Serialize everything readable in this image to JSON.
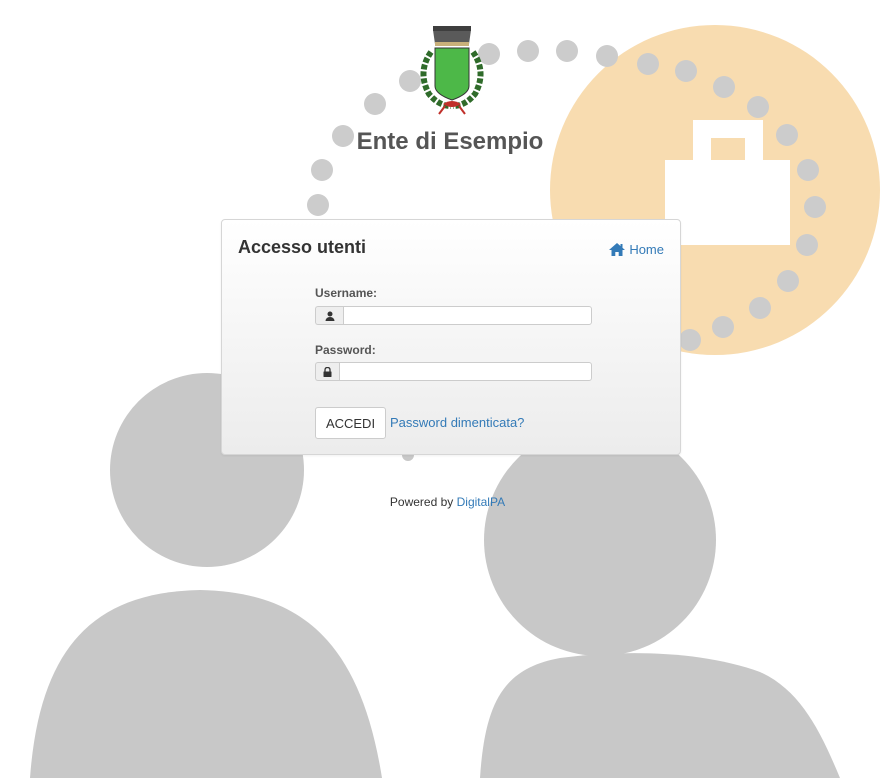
{
  "organization": {
    "name": "Ente di Esempio",
    "crest_icon": "coat-of-arms-icon"
  },
  "panel": {
    "title": "Accesso utenti",
    "home_label": "Home",
    "home_icon": "home-icon"
  },
  "form": {
    "username_label": "Username:",
    "username_value": "",
    "username_icon": "user-icon",
    "password_label": "Password:",
    "password_value": "",
    "password_icon": "lock-icon",
    "submit_label": "ACCEDI",
    "forgot_label": "Password dimenticata?"
  },
  "footer": {
    "prefix": "Powered by",
    "link_label": "DigitalPA"
  },
  "colors": {
    "accent_link": "#337ab7",
    "background_figures": "#c8c8c8",
    "lock_circle": "#f8dcb0"
  }
}
